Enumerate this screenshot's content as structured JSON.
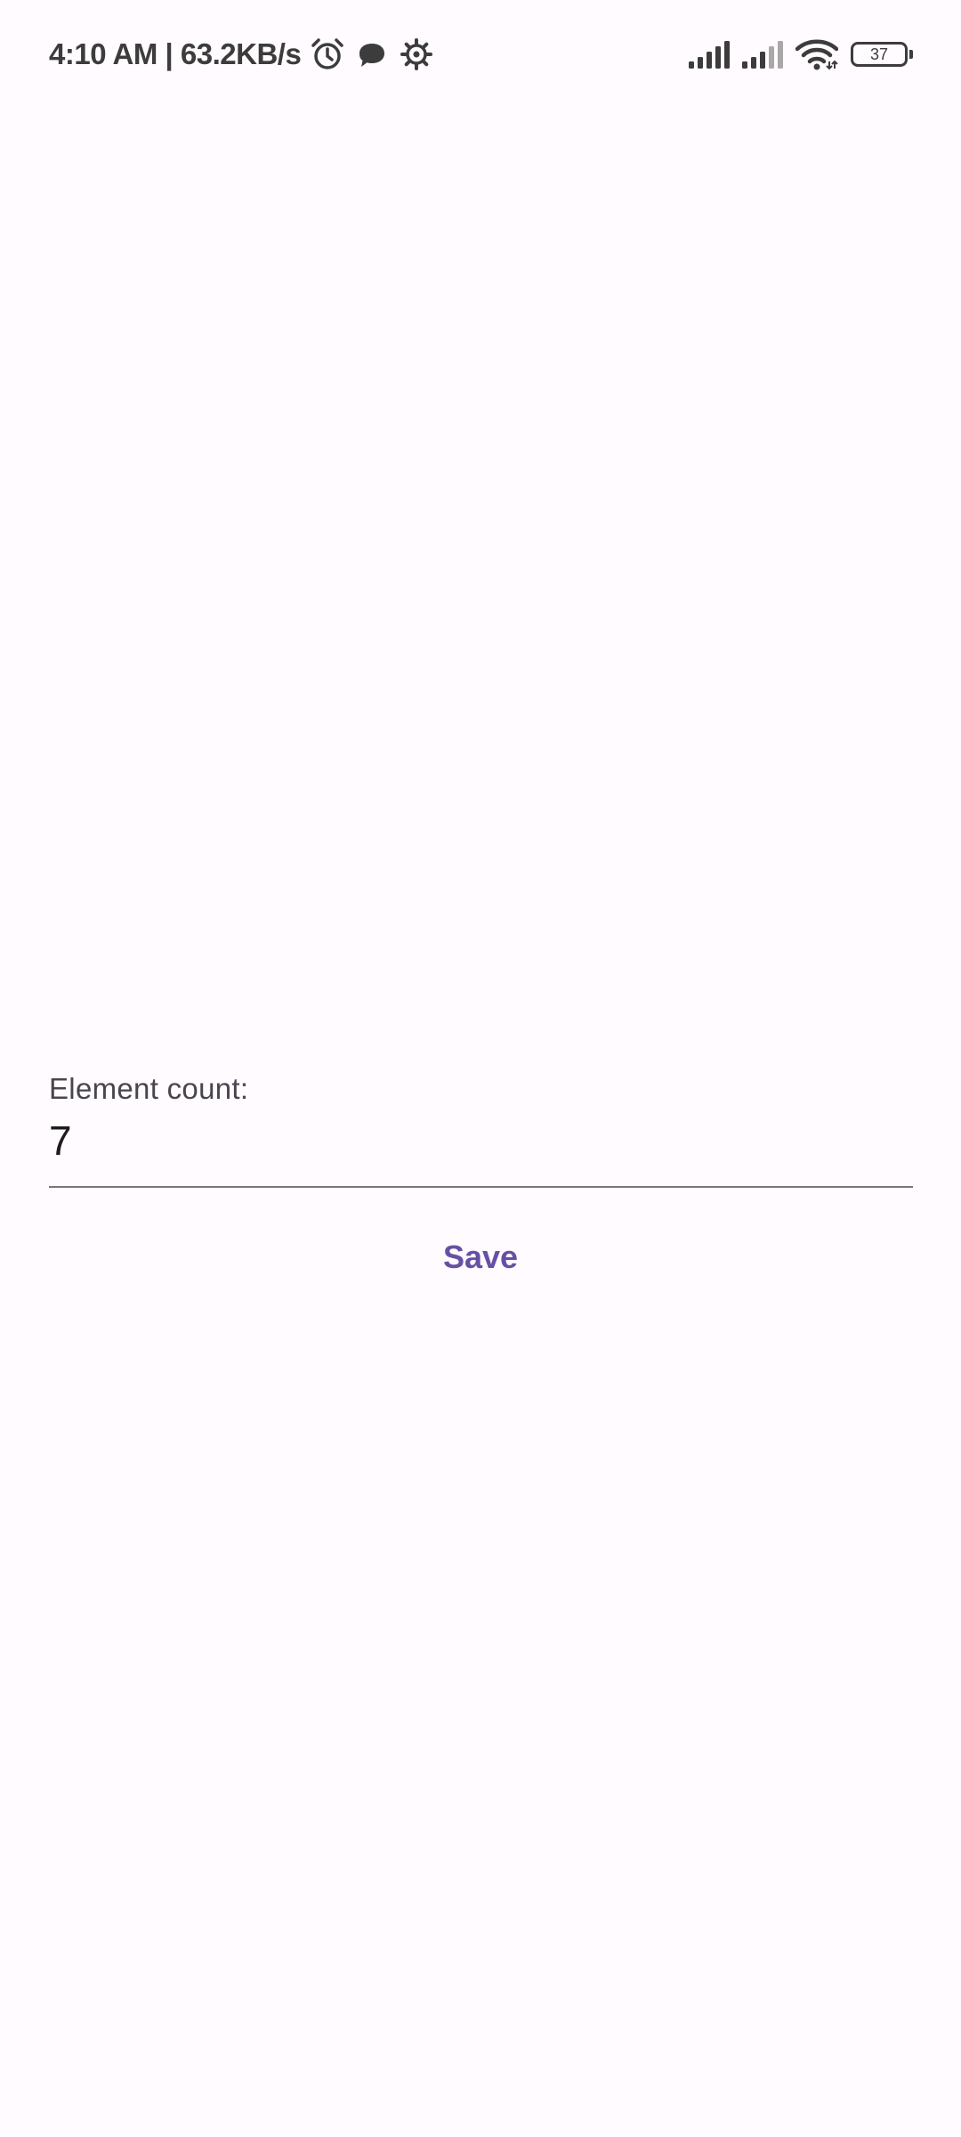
{
  "status_bar": {
    "time_speed": "4:10 AM | 63.2KB/s",
    "icons_left": [
      "alarm-icon",
      "chat-bubble-icon",
      "settings-gear-icon"
    ],
    "icons_right": [
      "signal-sim1-icon",
      "signal-sim2-icon",
      "wifi-icon"
    ],
    "battery_level": "37"
  },
  "form": {
    "label": "Element count:",
    "value": "7"
  },
  "actions": {
    "save_label": "Save"
  },
  "colors": {
    "background": "#fffbfe",
    "accent": "#6750a4",
    "label": "#49454f",
    "input_text": "#1c1b1f",
    "underline": "#79747e",
    "status": "#3c3c3c"
  }
}
